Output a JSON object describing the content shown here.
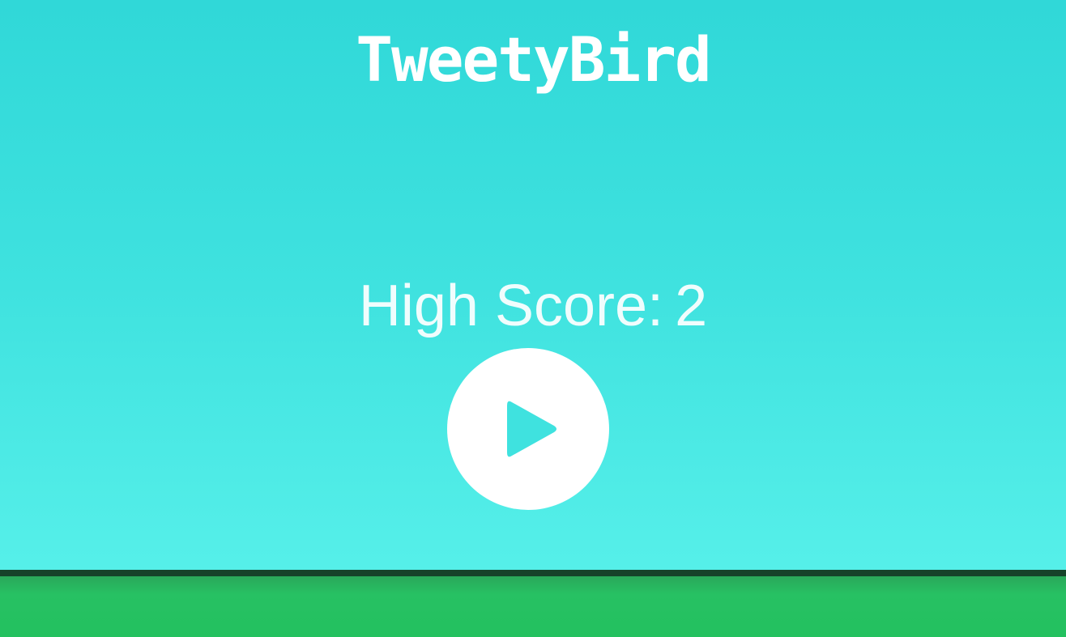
{
  "game": {
    "title": "TweetyBird",
    "high_score_label": "High Score:",
    "high_score_value": "2"
  },
  "controls": {
    "play_icon": "play-icon"
  },
  "colors": {
    "sky_top": "#30d8d8",
    "sky_bottom": "#58f0ea",
    "ground": "#23c15f",
    "ground_edge": "#16432a",
    "text": "#ffffff",
    "button": "#ffffff",
    "play_icon": "#3fe2df"
  }
}
